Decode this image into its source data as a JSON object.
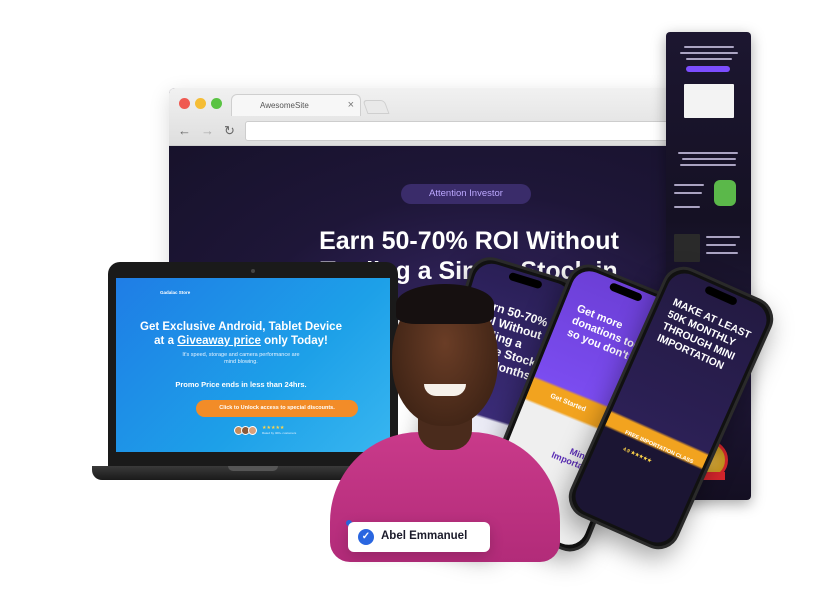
{
  "browser": {
    "tab_title": "AwesomeSite",
    "tab_close": "×",
    "pill": "Attention Investor",
    "hero_line1": "Earn 50-70% ROI Without",
    "hero_line2": "Trading a Single Stock in"
  },
  "laptop": {
    "logo": "Gadalac Store",
    "headline_1": "Get Exclusive Android, Tablet Device",
    "headline_2": "at a",
    "headline_link": "Giveaway price",
    "headline_3": "only Today!",
    "sub": "It's speed, storage and camera performance are mind blowing.",
    "promo": "Promo Price ends in less than 24hrs.",
    "cta": "Click to Unlock access to special discounts.",
    "stars": "★★★★★",
    "rating_text": "Rated by 400+ customers"
  },
  "phones": {
    "p1_title": "Earn 50-70% ROI Without Trading a Single Stock in Just Months",
    "p2_title": "Get more donations today so you don't pay",
    "p2_cta": "Get Started",
    "p2_card": "Mini Importation",
    "p3_title": "MAKE AT LEAST 50K MONTHLY THROUGH MINI IMPORTATION",
    "p3_banner": "FREE IMPORTATION CLASS",
    "p3_rating": "4.9 ★★★★★"
  },
  "nametag": {
    "name": "Abel Emmanuel",
    "check": "✓"
  },
  "colors": {
    "accent_purple": "#7c4dff",
    "laptop_blue": "#1f7de6",
    "cta_orange": "#f28c28",
    "shirt_pink": "#c93a8a",
    "verify_blue": "#2a66e0"
  }
}
